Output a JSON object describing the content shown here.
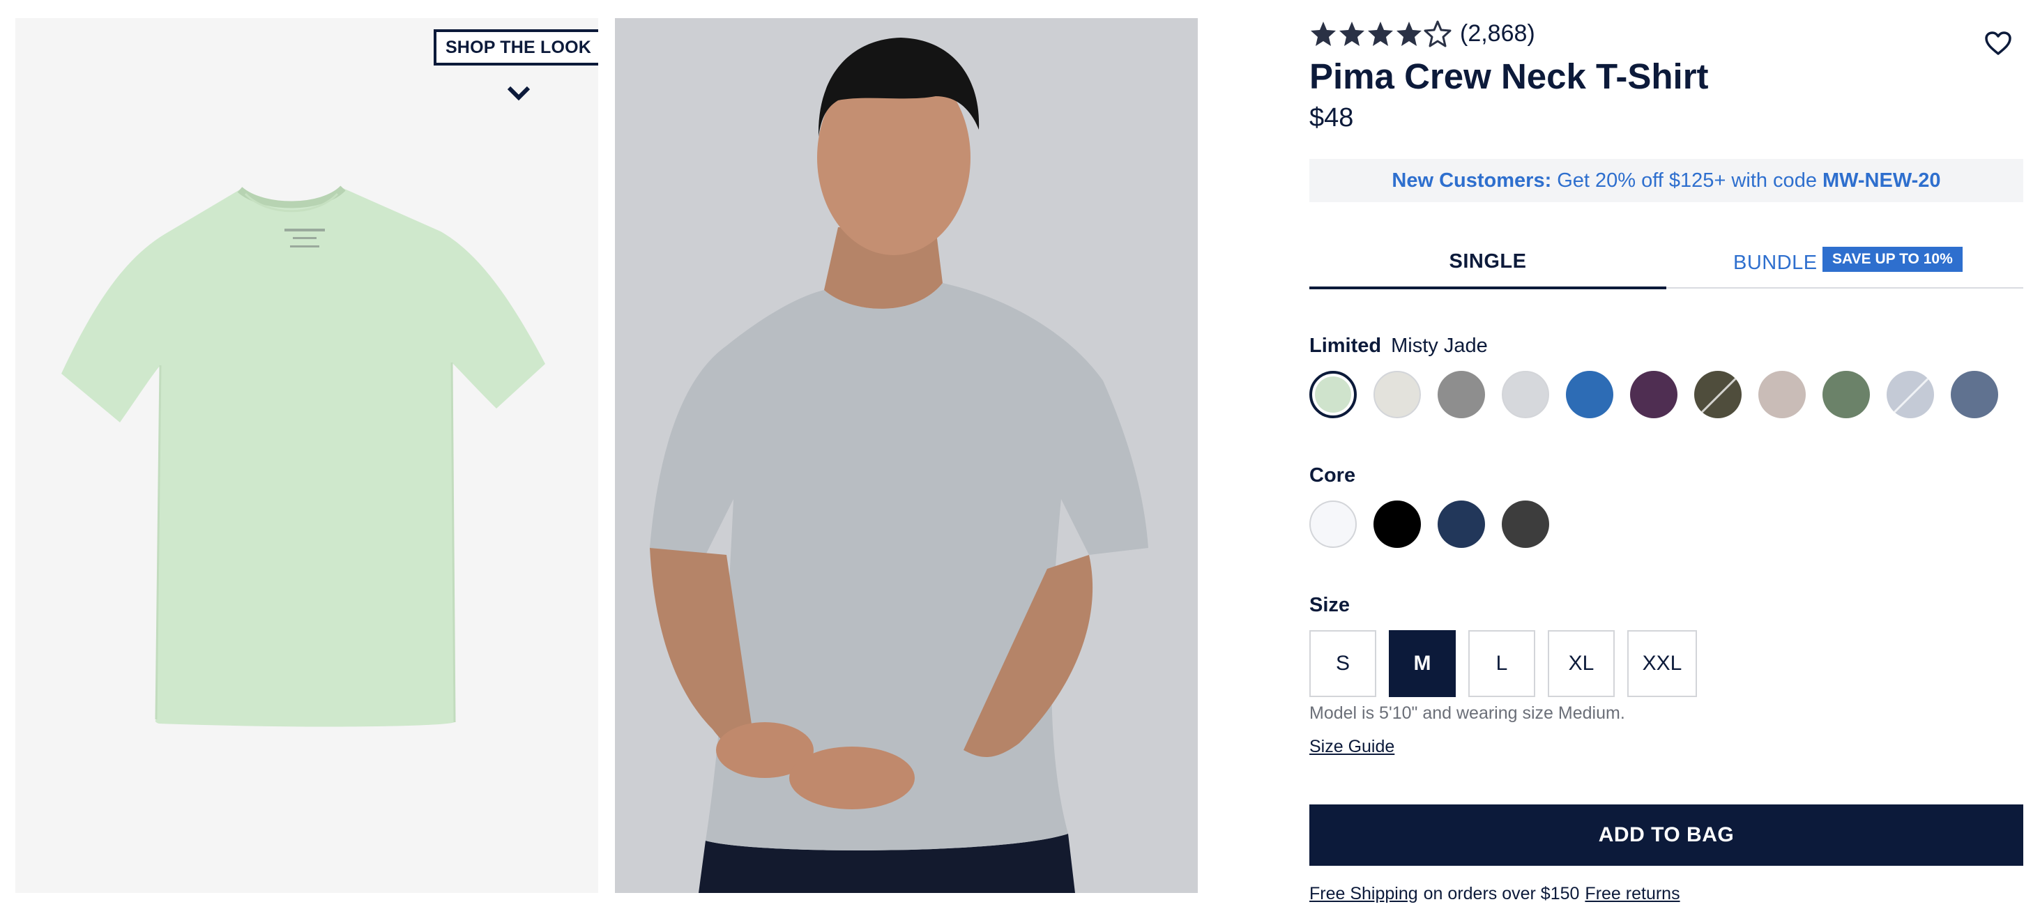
{
  "gallery": {
    "shop_the_look_label": "SHOP THE LOOK",
    "flat_shirt_color": "#cfe8cc",
    "model_shirt_color": "#b8bdc2",
    "flat_background": "#f5f5f5",
    "model_background": "#cdcfd3"
  },
  "product": {
    "rating": 4.5,
    "rating_max": 5,
    "review_count": "(2,868)",
    "title": "Pima Crew Neck T-Shirt",
    "price": "$48"
  },
  "promo": {
    "lead": "New Customers:",
    "text": "Get 20% off $125+ with code",
    "code": "MW-NEW-20"
  },
  "tabs": {
    "single": "SINGLE",
    "bundle": "BUNDLE",
    "bundle_badge": "SAVE UP TO 10%",
    "active": "single"
  },
  "colors": {
    "limited_label": "Limited",
    "selected_name": "Misty Jade",
    "limited": [
      {
        "name": "misty-jade",
        "hex": "#cfe3cc",
        "selected": true
      },
      {
        "name": "stone",
        "hex": "#e3e2dc"
      },
      {
        "name": "heather-grey",
        "hex": "#8e8e8e"
      },
      {
        "name": "light-grey",
        "hex": "#d6d8dc"
      },
      {
        "name": "blue",
        "hex": "#2d6cb5"
      },
      {
        "name": "plum",
        "hex": "#4f2e52"
      },
      {
        "name": "olive-stripe",
        "hex": "#4f4d3c",
        "striped": true
      },
      {
        "name": "taupe",
        "hex": "#c9bcb7"
      },
      {
        "name": "sage",
        "hex": "#6b8269"
      },
      {
        "name": "ice-stripe",
        "hex": "#c4cad6",
        "striped": true
      },
      {
        "name": "slate-blue",
        "hex": "#607290"
      }
    ],
    "core_label": "Core",
    "core": [
      {
        "name": "white",
        "hex": "#f6f7fa"
      },
      {
        "name": "black",
        "hex": "#000000"
      },
      {
        "name": "navy",
        "hex": "#22375a"
      },
      {
        "name": "charcoal",
        "hex": "#3d3d3d"
      }
    ]
  },
  "size": {
    "label": "Size",
    "options": [
      "S",
      "M",
      "L",
      "XL",
      "XXL"
    ],
    "selected": "M",
    "model_note": "Model is 5'10\" and wearing size Medium.",
    "guide": "Size Guide"
  },
  "cta": {
    "add_to_bag": "ADD TO BAG",
    "free_shipping": "Free Shipping",
    "shipping_text": "on orders over $150",
    "free_returns": "Free returns"
  },
  "icons": {
    "wishlist": "heart-icon",
    "shop_the_look": "chevron-down-icon",
    "rating": "star-icon"
  },
  "theme": {
    "navy": "#0c1a3a",
    "accent_blue": "#2e6fce"
  }
}
